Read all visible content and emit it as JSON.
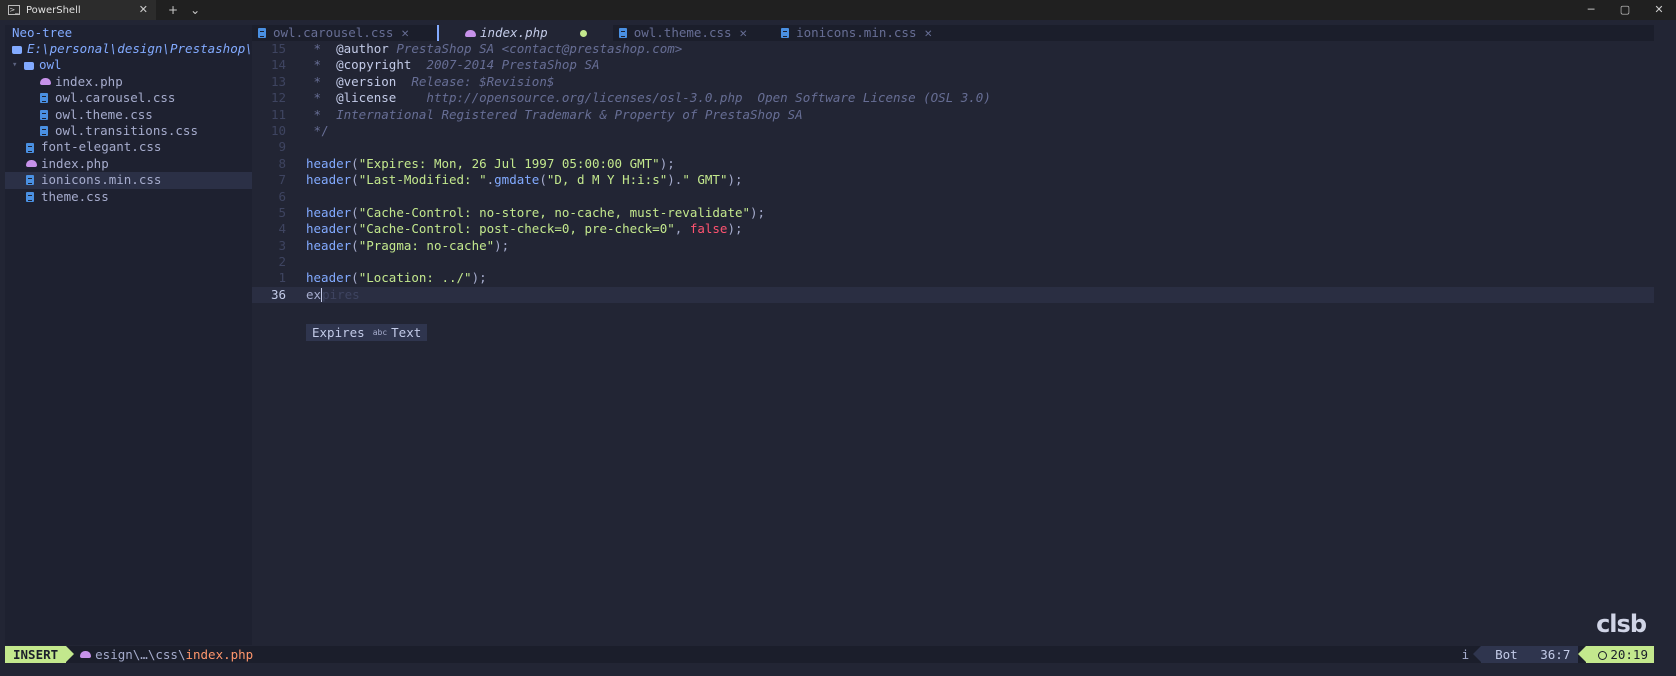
{
  "window": {
    "tab_title": "PowerShell",
    "tab_close": "✕",
    "new_tab": "+",
    "dropdown": "⌄",
    "minimize": "─",
    "maximize": "▢",
    "close": "✕"
  },
  "sidebar": {
    "title": "Neo-tree",
    "root": "E:\\personal\\design\\Prestashop\\T",
    "items": [
      {
        "name": "owl",
        "type": "dir",
        "depth": 1
      },
      {
        "name": "index.php",
        "type": "php",
        "depth": 2
      },
      {
        "name": "owl.carousel.css",
        "type": "css",
        "depth": 2
      },
      {
        "name": "owl.theme.css",
        "type": "css",
        "depth": 2
      },
      {
        "name": "owl.transitions.css",
        "type": "css",
        "depth": 2
      },
      {
        "name": "font-elegant.css",
        "type": "css",
        "depth": 1
      },
      {
        "name": "index.php",
        "type": "php",
        "depth": 1
      },
      {
        "name": "ionicons.min.css",
        "type": "css",
        "depth": 1,
        "selected": true
      },
      {
        "name": "theme.css",
        "type": "css",
        "depth": 1
      }
    ]
  },
  "tabs": [
    {
      "label": "owl.carousel.css",
      "close": "✕"
    },
    {
      "label": "index.php",
      "active": true
    },
    {
      "label": "owl.theme.css",
      "close": "✕"
    },
    {
      "label": "ionicons.min.css",
      "close": "✕"
    }
  ],
  "editor": {
    "lines": [
      {
        "n": "15",
        "tokens": [
          [
            "cm",
            " *  "
          ],
          [
            "cm-kw",
            "@author"
          ],
          [
            "cm-i",
            " PrestaShop SA <contact@prestashop.com>"
          ]
        ]
      },
      {
        "n": "14",
        "tokens": [
          [
            "cm",
            " *  "
          ],
          [
            "cm-kw",
            "@copyright"
          ],
          [
            "cm-i",
            "  2007-2014 PrestaShop SA"
          ]
        ]
      },
      {
        "n": "13",
        "tokens": [
          [
            "cm",
            " *  "
          ],
          [
            "cm-kw",
            "@version"
          ],
          [
            "cm-i",
            "  Release: $Revision$"
          ]
        ]
      },
      {
        "n": "12",
        "tokens": [
          [
            "cm",
            " *  "
          ],
          [
            "cm-kw",
            "@license"
          ],
          [
            "cm-i",
            "    http://opensource.org/licenses/osl-3.0.php  Open Software License (OSL 3.0)"
          ]
        ]
      },
      {
        "n": "11",
        "tokens": [
          [
            "cm",
            " *  "
          ],
          [
            "cm-i",
            "International Registered Trademark & Property of PrestaShop SA"
          ]
        ]
      },
      {
        "n": "10",
        "tokens": [
          [
            "cm",
            " */"
          ]
        ]
      },
      {
        "n": "9",
        "tokens": []
      },
      {
        "n": "8",
        "tokens": [
          [
            "fn",
            "header"
          ],
          [
            "pun",
            "("
          ],
          [
            "str",
            "\"Expires: Mon, 26 Jul 1997 05:00:00 GMT\""
          ],
          [
            "pun",
            ");"
          ]
        ]
      },
      {
        "n": "7",
        "tokens": [
          [
            "fn",
            "header"
          ],
          [
            "pun",
            "("
          ],
          [
            "str",
            "\"Last-Modified: \""
          ],
          [
            "pun",
            "."
          ],
          [
            "fn",
            "gmdate"
          ],
          [
            "pun",
            "("
          ],
          [
            "str",
            "\"D, d M Y H:i:s\""
          ],
          [
            "pun",
            ")."
          ],
          [
            "str",
            "\" GMT\""
          ],
          [
            "pun",
            ");"
          ]
        ]
      },
      {
        "n": "6",
        "tokens": []
      },
      {
        "n": "5",
        "tokens": [
          [
            "fn",
            "header"
          ],
          [
            "pun",
            "("
          ],
          [
            "str",
            "\"Cache-Control: no-store, no-cache, must-revalidate\""
          ],
          [
            "pun",
            ");"
          ]
        ]
      },
      {
        "n": "4",
        "tokens": [
          [
            "fn",
            "header"
          ],
          [
            "pun",
            "("
          ],
          [
            "str",
            "\"Cache-Control: post-check=0, pre-check=0\""
          ],
          [
            "pun",
            ", "
          ],
          [
            "bool",
            "false"
          ],
          [
            "pun",
            ");"
          ]
        ]
      },
      {
        "n": "3",
        "tokens": [
          [
            "fn",
            "header"
          ],
          [
            "pun",
            "("
          ],
          [
            "str",
            "\"Pragma: no-cache\""
          ],
          [
            "pun",
            ");"
          ]
        ]
      },
      {
        "n": "2",
        "tokens": []
      },
      {
        "n": "1",
        "tokens": [
          [
            "fn",
            "header"
          ],
          [
            "pun",
            "("
          ],
          [
            "str",
            "\"Location: ../\""
          ],
          [
            "pun",
            ");"
          ]
        ]
      },
      {
        "n": "36",
        "current": true,
        "tokens": [
          [
            "pun",
            "ex"
          ],
          [
            "cursor",
            ""
          ],
          [
            "ghost",
            "pires"
          ]
        ]
      }
    ],
    "completion": {
      "word": "Expires",
      "kind_icon": "abc",
      "kind": "Text"
    }
  },
  "logo": "clsb",
  "status": {
    "mode": "INSERT",
    "path_prefix": "esign\\…\\css\\",
    "path_file": "index.php",
    "indicator": "i",
    "scroll": "Bot",
    "position": "36:7",
    "time": "20:19"
  }
}
